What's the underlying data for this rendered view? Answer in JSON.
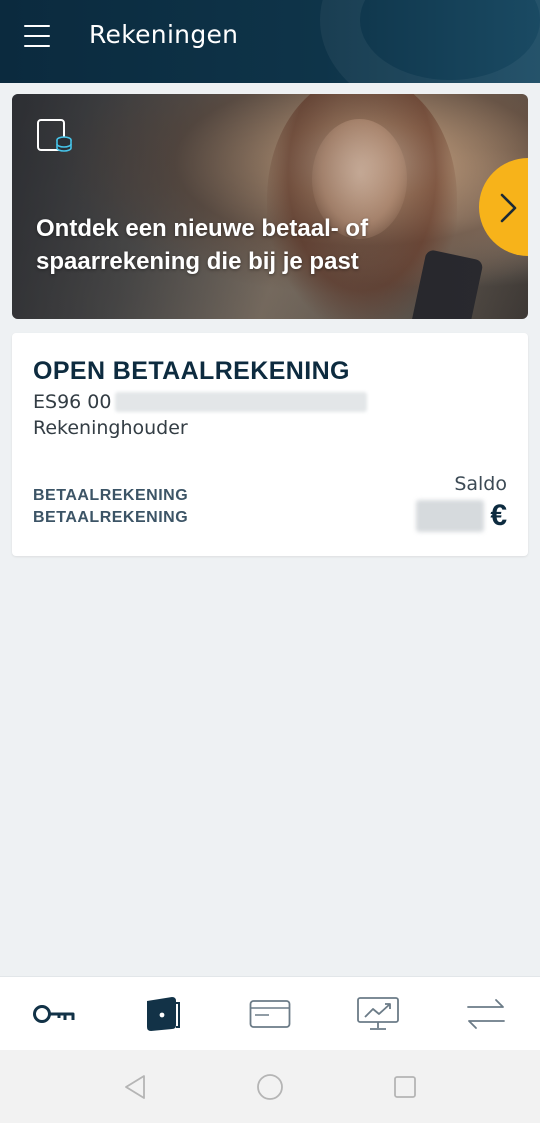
{
  "header": {
    "title": "Rekeningen",
    "menu_icon": "hamburger-menu-icon"
  },
  "banner": {
    "text": "Ontdek een nieuwe betaal- of spaarrekening die bij je past",
    "icon": "account-database-icon",
    "next_icon": "chevron-right-icon",
    "accent_color": "#f7b31a"
  },
  "account": {
    "name": "OPEN BETAALREKENING",
    "iban_prefix": "ES96 00",
    "role": "Rekeninghouder",
    "type_line1": "BETAALREKENING",
    "type_line2": "BETAALREKENING",
    "saldo_label": "Saldo",
    "currency": "€"
  },
  "bottom_nav": {
    "items": [
      {
        "icon": "key-icon",
        "active": false
      },
      {
        "icon": "wallet-icon",
        "active": true
      },
      {
        "icon": "card-icon",
        "active": false
      },
      {
        "icon": "investments-chart-icon",
        "active": false
      },
      {
        "icon": "transfer-arrows-icon",
        "active": false
      }
    ]
  },
  "system_nav": {
    "items": [
      "back-icon",
      "home-icon",
      "recents-icon"
    ]
  },
  "colors": {
    "header_bg": "#0b2a3e",
    "primary_text": "#0d2b3f",
    "page_bg": "#eef1f3"
  }
}
